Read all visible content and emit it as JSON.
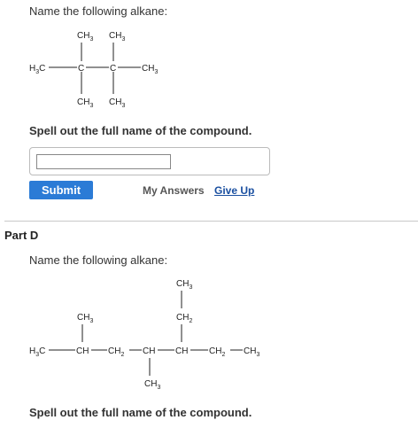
{
  "part_c": {
    "prompt": "Name the following alkane:",
    "spell_label": "Spell out the full name of the compound.",
    "input_value": "",
    "submit_label": "Submit",
    "my_answers_label": "My Answers",
    "give_up_label": "Give Up",
    "structure": {
      "top_left": "CH3",
      "top_right": "CH3",
      "left_end": "H3C",
      "carbon_1": "C",
      "carbon_2": "C",
      "right_end": "CH3",
      "bottom_left": "CH3",
      "bottom_right": "CH3"
    }
  },
  "part_d": {
    "title": "Part D",
    "prompt": "Name the following alkane:",
    "spell_label": "Spell out the full name of the compound.",
    "structure": {
      "top_ch3": "CH3",
      "ch2_branch": "CH2",
      "left_branch_ch3": "CH3",
      "main_chain": [
        "H3C",
        "CH",
        "CH2",
        "CH",
        "CH",
        "CH2",
        "CH3"
      ],
      "bottom_ch3": "CH3"
    }
  }
}
